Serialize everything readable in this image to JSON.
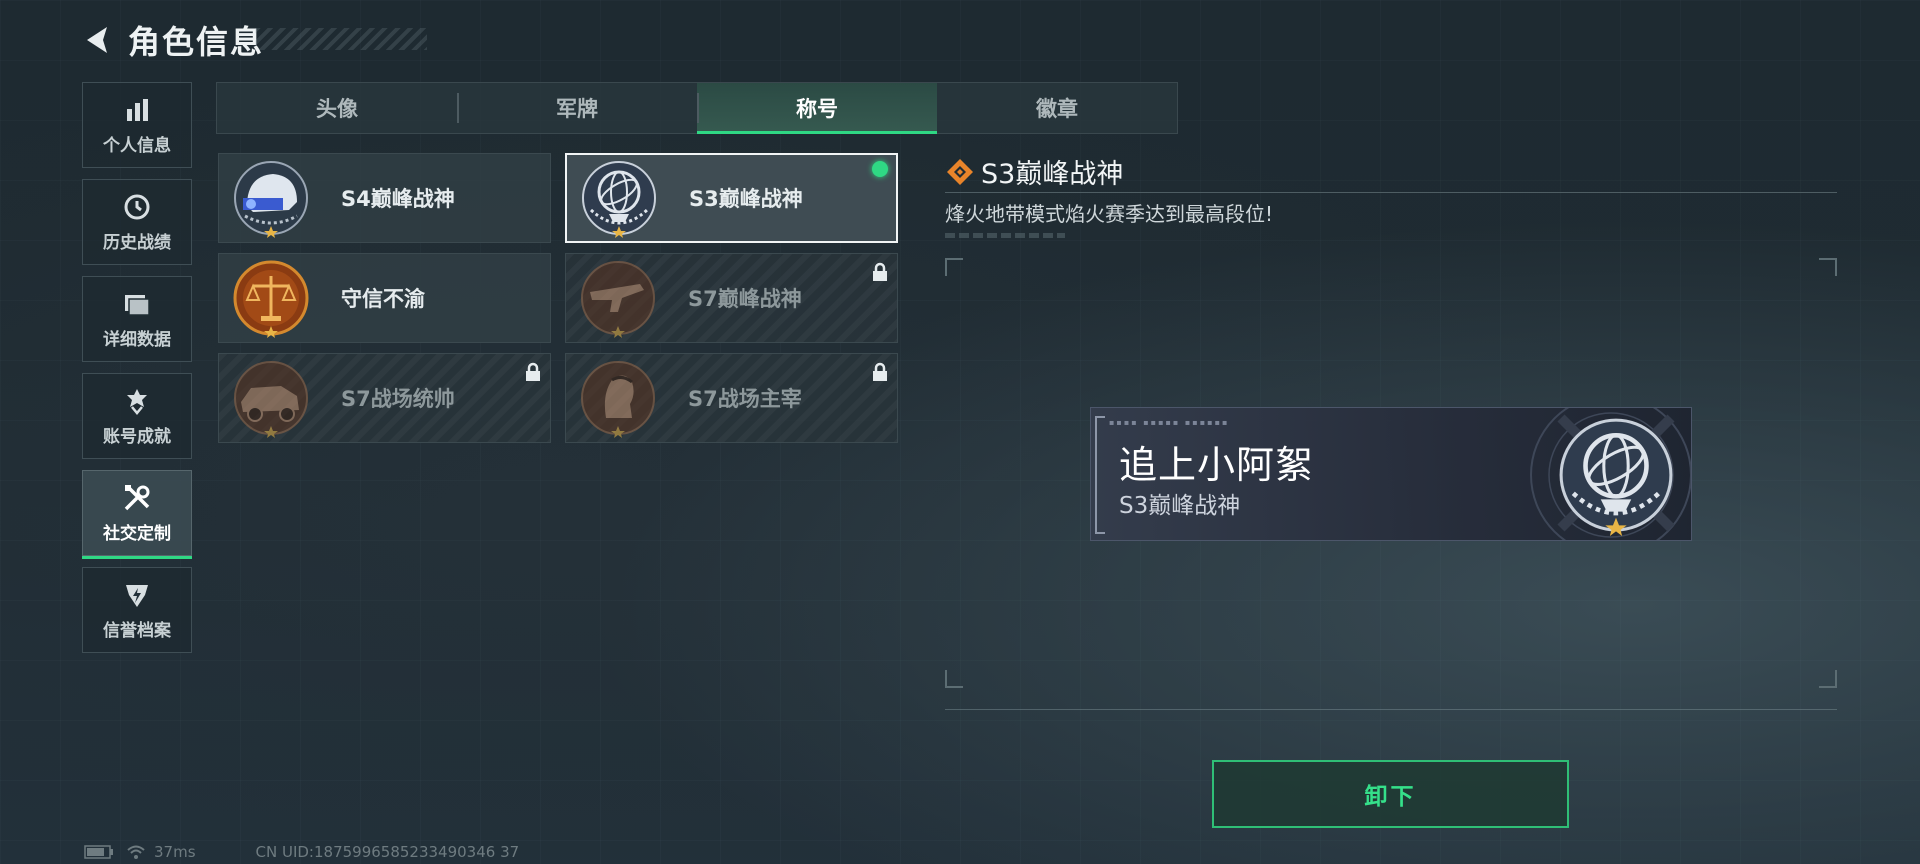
{
  "header": {
    "title": "角色信息"
  },
  "sidebar": {
    "items": [
      {
        "label": "个人信息",
        "icon": "bar-chart-icon",
        "active": false
      },
      {
        "label": "历史战绩",
        "icon": "history-icon",
        "active": false
      },
      {
        "label": "详细数据",
        "icon": "folder-icon",
        "active": false
      },
      {
        "label": "账号成就",
        "icon": "achievement-icon",
        "active": false
      },
      {
        "label": "社交定制",
        "icon": "tools-icon",
        "active": true
      },
      {
        "label": "信誉档案",
        "icon": "credit-icon",
        "active": false
      }
    ]
  },
  "tabs": [
    {
      "label": "头像",
      "active": false
    },
    {
      "label": "军牌",
      "active": false
    },
    {
      "label": "称号",
      "active": true
    },
    {
      "label": "徽章",
      "active": false
    }
  ],
  "titles": [
    {
      "label": "S4巅峰战神",
      "emblem": "helmet-emblem",
      "locked": false,
      "selected": false,
      "equipped": false
    },
    {
      "label": "S3巅峰战神",
      "emblem": "globe-emblem",
      "locked": false,
      "selected": true,
      "equipped": true
    },
    {
      "label": "守信不渝",
      "emblem": "scales-emblem",
      "locked": false,
      "selected": false,
      "equipped": false
    },
    {
      "label": "S7巅峰战神",
      "emblem": "rifle-emblem",
      "locked": true,
      "selected": false,
      "equipped": false
    },
    {
      "label": "S7战场统帅",
      "emblem": "vehicle-emblem",
      "locked": true,
      "selected": false,
      "equipped": false
    },
    {
      "label": "S7战场主宰",
      "emblem": "soldier-emblem",
      "locked": true,
      "selected": false,
      "equipped": false
    }
  ],
  "detail": {
    "title": "S3巅峰战神",
    "description": "烽火地带模式焰火赛季达到最高段位!"
  },
  "preview": {
    "player_name": "追上小阿絮",
    "title": "S3巅峰战神"
  },
  "actions": {
    "unequip_label": "卸下"
  },
  "status": {
    "ping": "37ms",
    "uid": "CN UID:1875996585233490346 37"
  },
  "colors": {
    "accent_green": "#2fd884",
    "detail_icon_orange": "#e8842a"
  }
}
